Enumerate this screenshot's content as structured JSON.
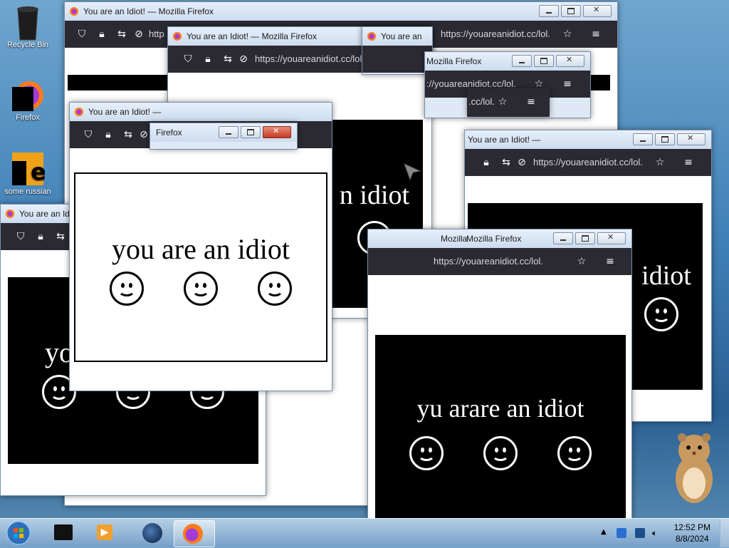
{
  "desktop": {
    "icons": [
      {
        "label": "Recycle Bin"
      },
      {
        "label": "Firefox"
      },
      {
        "label": "some russian"
      }
    ]
  },
  "window": {
    "title": "You are an Idiot! — Mozilla Firefox",
    "title_short": "You are an Idiot! —",
    "title_cut": "You are an",
    "title_fragment_mozilla": "Mozilla",
    "title_fragment_firefox": "Firefox",
    "title_mozilla_firefox": "Mozilla Firefox",
    "title_tail": "— Mozilla Firefox",
    "url": "https://youareanidiot.cc/lol.",
    "url_short": "http",
    "url_mid": "areanidiot.cc/lol.",
    "url_tail": "://youareanidiot.cc/lol.",
    "url_frag": ".cc/lol.",
    "url_frag2": "uareanidiot.cc/lo",
    "url_ss": "https://youareanidiot.cc/lol."
  },
  "page": {
    "message": "you are an idiot",
    "message_partial": "n idiot",
    "message_start": "yo",
    "message_overlap": "yu arare an idiot",
    "message_edge": "idiot",
    "frag_ouarea": "ouarea"
  },
  "taskbar": {
    "time": "12:52 PM",
    "date": "8/8/2024"
  },
  "colors": {
    "toolbar": "#2b2a33",
    "panel_black": "#000000",
    "panel_white": "#ffffff"
  }
}
